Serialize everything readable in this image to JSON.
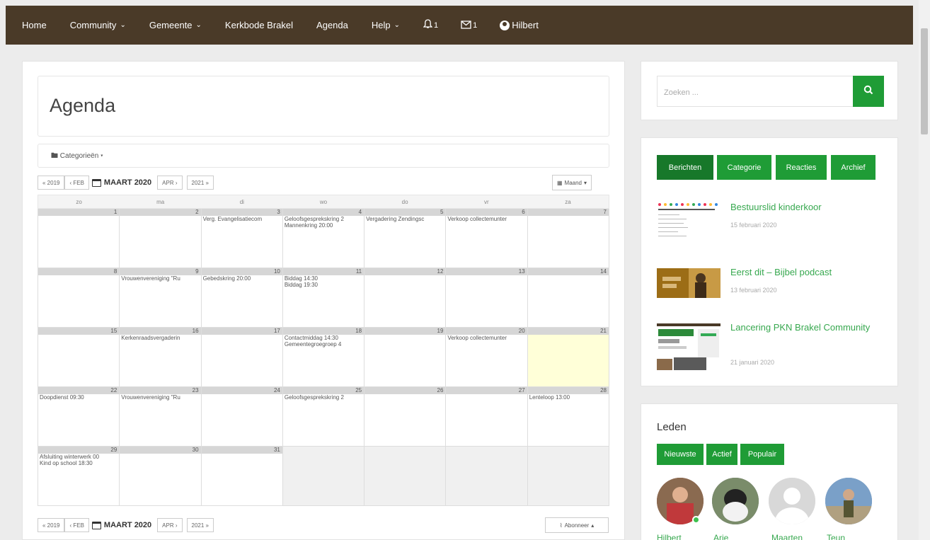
{
  "nav": {
    "home": "Home",
    "community": "Community",
    "gemeente": "Gemeente",
    "kerkbode": "Kerkbode Brakel",
    "agenda": "Agenda",
    "help": "Help",
    "notif_count": "1",
    "msg_count": "1",
    "user": "Hilbert"
  },
  "page": {
    "title": "Agenda"
  },
  "categories_label": "Categorieën",
  "calendar": {
    "prev_year": "« 2019",
    "prev_month": "‹ FEB",
    "current": "MAART 2020",
    "next_month": "APR ›",
    "next_year": "2021 »",
    "view": "Maand",
    "subscribe": "Abonneer",
    "weekdays": [
      "zo",
      "ma",
      "di",
      "wo",
      "do",
      "vr",
      "za"
    ],
    "weeks": [
      [
        {
          "day": "1",
          "events": []
        },
        {
          "day": "2",
          "events": []
        },
        {
          "day": "3",
          "events": [
            "Verg. Evangelisatiecom"
          ]
        },
        {
          "day": "4",
          "events": [
            "Geloofsgesprekskring 2",
            "Mannenkring 20:00"
          ]
        },
        {
          "day": "5",
          "events": [
            "Vergadering Zendingsc"
          ]
        },
        {
          "day": "6",
          "events": [
            "Verkoop collectemunter"
          ]
        },
        {
          "day": "7",
          "events": []
        }
      ],
      [
        {
          "day": "8",
          "events": []
        },
        {
          "day": "9",
          "events": [
            "Vrouwenvereniging \"Ru"
          ]
        },
        {
          "day": "10",
          "events": [
            "Gebedskring 20:00"
          ]
        },
        {
          "day": "11",
          "events": [
            "Biddag 14:30",
            "Biddag 19:30"
          ]
        },
        {
          "day": "12",
          "events": []
        },
        {
          "day": "13",
          "events": []
        },
        {
          "day": "14",
          "events": []
        }
      ],
      [
        {
          "day": "15",
          "events": []
        },
        {
          "day": "16",
          "events": [
            "Kerkenraadsvergaderin"
          ]
        },
        {
          "day": "17",
          "events": []
        },
        {
          "day": "18",
          "events": [
            "Contactmiddag 14:30",
            "Gemeentegroegroep 4"
          ]
        },
        {
          "day": "19",
          "events": []
        },
        {
          "day": "20",
          "events": [
            "Verkoop collectemunter"
          ]
        },
        {
          "day": "21",
          "events": [],
          "today": true
        }
      ],
      [
        {
          "day": "22",
          "events": [
            "Doopdienst 09:30"
          ]
        },
        {
          "day": "23",
          "events": [
            "Vrouwenvereniging \"Ru"
          ]
        },
        {
          "day": "24",
          "events": []
        },
        {
          "day": "25",
          "events": [
            "Geloofsgesprekskring 2"
          ]
        },
        {
          "day": "26",
          "events": []
        },
        {
          "day": "27",
          "events": []
        },
        {
          "day": "28",
          "events": [
            "Lenteloop 13:00"
          ]
        }
      ],
      [
        {
          "day": "29",
          "events": [
            "Afsluiting winterwerk 00",
            "Kind op school 18:30"
          ]
        },
        {
          "day": "30",
          "events": []
        },
        {
          "day": "31",
          "events": []
        },
        {
          "day": "",
          "events": [],
          "out": true
        },
        {
          "day": "",
          "events": [],
          "out": true
        },
        {
          "day": "",
          "events": [],
          "out": true
        },
        {
          "day": "",
          "events": [],
          "out": true
        }
      ]
    ]
  },
  "sidebar": {
    "search_placeholder": "Zoeken ...",
    "tabs": [
      "Berichten",
      "Categorie",
      "Reacties",
      "Archief"
    ],
    "posts": [
      {
        "title": "Bestuurslid kinderkoor",
        "date": "15 februari 2020"
      },
      {
        "title": "Eerst dit – Bijbel podcast",
        "date": "13 februari 2020"
      },
      {
        "title": "Lancering PKN Brakel Community",
        "date": "21 januari 2020"
      }
    ],
    "leden_title": "Leden",
    "leden_tabs": [
      "Nieuwste",
      "Actief",
      "Populair"
    ],
    "members": [
      "Hilbert",
      "Arie",
      "Maarten",
      "Teun"
    ]
  },
  "colors": {
    "nav_bg": "#4a3a28",
    "accent": "#1f9c36",
    "today": "#ffffd8"
  }
}
